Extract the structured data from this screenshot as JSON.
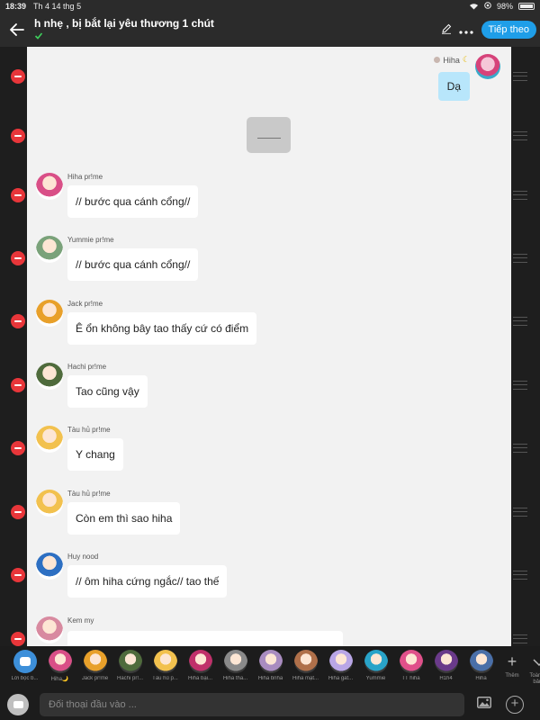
{
  "status": {
    "time": "18:39",
    "date": "Th 4 14 thg 5",
    "battery": "98%",
    "battery_level": 0.98
  },
  "header": {
    "title": "h nhẹ , bị bắt lại yêu thương 1 chút",
    "subtitle": "",
    "follow_label": "Tiếp theo"
  },
  "self_message": {
    "sender": "Hiha",
    "text": "Dạ"
  },
  "messages": [
    {
      "sender": "Hiha pr!me",
      "text": "// bước qua cánh cổng//",
      "color": "#d94f87"
    },
    {
      "sender": "Yummie pr!me",
      "text": "// bước qua cánh cổng//",
      "color": "#7aa27a"
    },
    {
      "sender": "Jack pr!me",
      "text": "Ê ổn không bây tao thấy cứ có điểm",
      "color": "#e8a02a"
    },
    {
      "sender": "Hachi pr!me",
      "text": "Tao cũng vậy",
      "color": "#4f6b3c"
    },
    {
      "sender": "Tàu hủ pr!me",
      "text": "Y chang",
      "color": "#f2c14e"
    },
    {
      "sender": "Tàu hủ pr!me",
      "text": "Còn em thì sao hiha",
      "color": "#f2c14e"
    },
    {
      "sender": "Huy nood",
      "text": "// ôm hiha  cứng ngắc// tao thế",
      "color": "#2d6fc2"
    },
    {
      "sender": "Kem my",
      "text": "",
      "color": "#d88aa0"
    }
  ],
  "members": [
    {
      "name": "Lời bọc b...",
      "color": "#3d8fd9"
    },
    {
      "name": "Hiha🌙",
      "color": "#d94f87"
    },
    {
      "name": "Jack pr!me",
      "color": "#e8a02a"
    },
    {
      "name": "Hachi pr!...",
      "color": "#4f6b3c"
    },
    {
      "name": "Tàu hủ p...",
      "color": "#f2c14e"
    },
    {
      "name": "Hiha bại...",
      "color": "#c0306a"
    },
    {
      "name": "Hiha tha...",
      "color": "#8a8a8a"
    },
    {
      "name": "Hiha bnha",
      "color": "#a98cc0"
    },
    {
      "name": "Hiha mặt...",
      "color": "#b0704a"
    },
    {
      "name": "Hiha gat...",
      "color": "#b9a6e6"
    },
    {
      "name": "Yummie",
      "color": "#29a3c8"
    },
    {
      "name": "TT hiha",
      "color": "#e0508a"
    },
    {
      "name": "H1h4",
      "color": "#6a3a8a"
    },
    {
      "name": "Hiha",
      "color": "#4a6fa8"
    }
  ],
  "tools": {
    "add_label": "Thêm",
    "all_label": "Toàn bộ bảng"
  },
  "input": {
    "placeholder": "Đối thoại đầu vào ..."
  },
  "icons": {
    "back": "back-arrow-icon",
    "edit": "pencil-icon",
    "more": "more-dots-icon",
    "image": "image-icon",
    "plus": "plus-icon",
    "wifi": "wifi-icon"
  }
}
